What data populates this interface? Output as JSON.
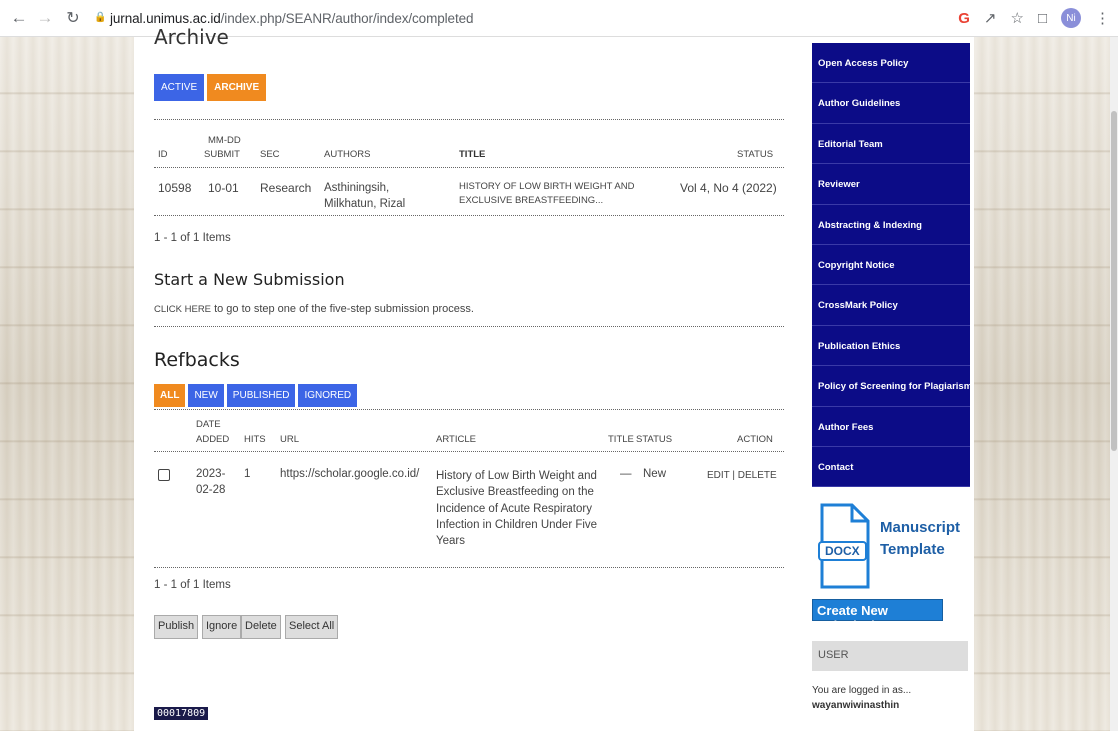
{
  "browser": {
    "url_domain": "jurnal.unimus.ac.id",
    "url_path": "/index.php/SEANR/author/index/completed",
    "avatar": "Ni",
    "icons": [
      "back-icon",
      "forward-icon",
      "reload-icon",
      "lock-icon",
      "google-icon",
      "share-icon",
      "star-icon",
      "sidepanel-icon",
      "menu-icon"
    ]
  },
  "archive": {
    "heading": "Archive",
    "tabs": [
      "ACTIVE",
      "ARCHIVE"
    ],
    "columns": {
      "id": "ID",
      "mmdd": "MM-DD",
      "submit": "SUBMIT",
      "sec": "SEC",
      "authors": "AUTHORS",
      "title": "TITLE",
      "status": "STATUS"
    },
    "row": {
      "id": "10598",
      "date": "10-01",
      "sec": "Research",
      "authors_1": "Asthiningsih,",
      "authors_2": "Milkhatun, Rizal",
      "title_1": "HISTORY OF LOW BIRTH WEIGHT AND",
      "title_2": "EXCLUSIVE BREASTFEEDING...",
      "status": "Vol 4, No 4 (2022)"
    },
    "count": "1 - 1 of 1 Items"
  },
  "new_submission": {
    "heading": "Start a New Submission",
    "link": "CLICK HERE",
    "text": "to go to step one of the five-step submission process."
  },
  "refbacks": {
    "heading": "Refbacks",
    "tabs": [
      "ALL",
      "NEW",
      "PUBLISHED",
      "IGNORED"
    ],
    "columns": {
      "date": "DATE",
      "added": "ADDED",
      "hits": "HITS",
      "url": "URL",
      "article": "ARTICLE",
      "title": "TITLE",
      "status": "STATUS",
      "action": "ACTION"
    },
    "row": {
      "date_1": "2023-",
      "date_2": "02-28",
      "hits": "1",
      "url": "https://scholar.google.co.id/",
      "article": [
        "History of Low Birth Weight and",
        "Exclusive Breastfeeding on the",
        "Incidence of Acute Respiratory",
        "Infection in Children Under Five",
        "Years"
      ],
      "title": "—",
      "status": "New",
      "edit": "EDIT",
      "delete": "DELETE"
    },
    "count": "1 - 1 of 1 Items",
    "buttons": [
      "Publish",
      "Ignore",
      "Delete",
      "Select All"
    ]
  },
  "footer_id": "00017809",
  "sidebar": {
    "menu": [
      "Open Access Policy",
      "Author Guidelines",
      "Editorial Team",
      "Reviewer",
      "Abstracting & Indexing",
      "Copyright Notice",
      "CrossMark Policy",
      "Publication Ethics",
      "Policy of Screening for Plagiarism",
      "Author Fees",
      "Contact"
    ],
    "template_badge": "DOCX",
    "template_line1": "Manuscript",
    "template_line2": "Template",
    "create_button": "Create New Submission",
    "user_heading": "USER",
    "logged_in_as": "You are logged in as...",
    "username": "wayanwiwinasthin"
  }
}
